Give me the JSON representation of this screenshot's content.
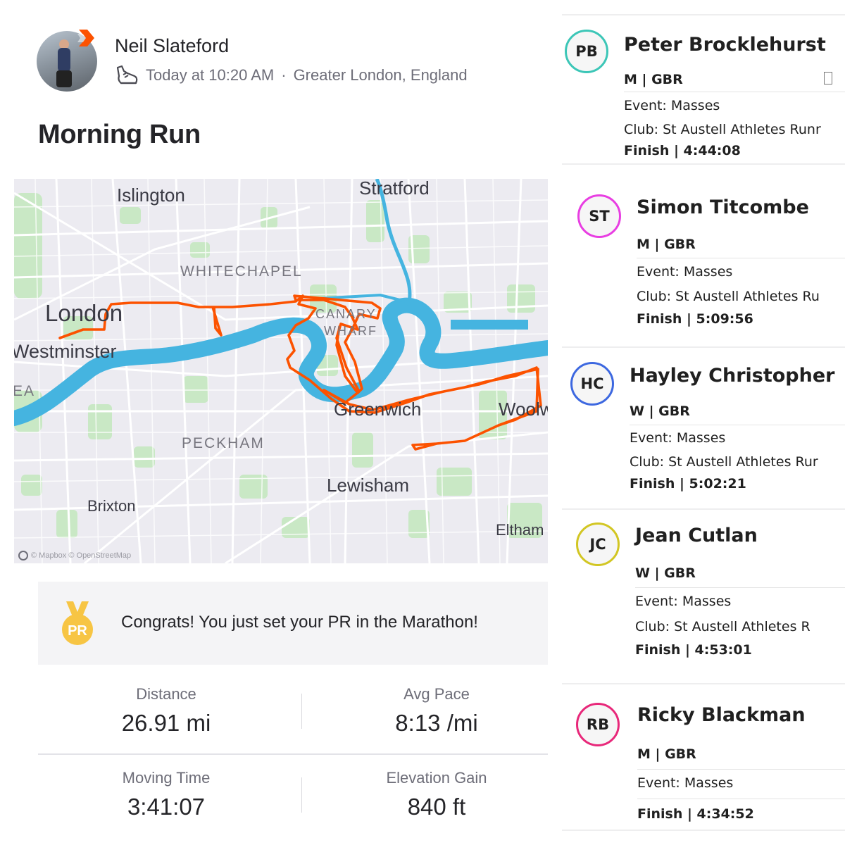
{
  "activity": {
    "athlete_name": "Neil Slateford",
    "timestamp": "Today at 10:20 AM",
    "location": "Greater London, England",
    "meta_separator": "·",
    "title": "Morning Run",
    "activity_icon": "running-shoe-icon",
    "accent_color": "#fc5200"
  },
  "map": {
    "labels": {
      "islington": "Islington",
      "stratford": "Stratford",
      "whitechapel": "WHITECHAPEL",
      "london": "London",
      "canary_wharf_1": "CANARY",
      "canary_wharf_2": "WHARF",
      "westminster": "Westminster",
      "ea": "EA",
      "greenwich": "Greenwich",
      "woolwich": "Woolw",
      "peckham": "PECKHAM",
      "lewisham": "Lewisham",
      "brixton": "Brixton",
      "eltham": "Eltham"
    },
    "attribution": "© Mapbox © OpenStreetMap",
    "route_color": "#fc5200",
    "river_color": "#45b4e0",
    "park_color": "#c9e8c5"
  },
  "pr": {
    "medal_text": "PR",
    "message": "Congrats! You just set your PR in the Marathon!",
    "medal_color": "#f7c544"
  },
  "stats": {
    "distance_label": "Distance",
    "distance_value": "26.91 mi",
    "pace_label": "Avg Pace",
    "pace_value": "8:13 /mi",
    "moving_time_label": "Moving Time",
    "moving_time_value": "3:41:07",
    "elevation_label": "Elevation Gain",
    "elevation_value": "840 ft"
  },
  "runners": [
    {
      "initials": "PB",
      "name": "Peter Brocklehurst",
      "category": "M | GBR",
      "event": "Event: Masses",
      "club": "Club: St Austell Athletes Runr",
      "finish": "Finish | 4:44:08",
      "ring_color": "#3cc6b7"
    },
    {
      "initials": "ST",
      "name": "Simon Titcombe",
      "category": "M | GBR",
      "event": "Event: Masses",
      "club": "Club: St Austell Athletes Ru",
      "finish": "Finish | 5:09:56",
      "ring_color": "#e83ee2"
    },
    {
      "initials": "HC",
      "name": "Hayley Christopher",
      "category": "W | GBR",
      "event": "Event: Masses",
      "club": "Club: St Austell Athletes Rur",
      "finish": "Finish | 5:02:21",
      "ring_color": "#3d68e0"
    },
    {
      "initials": "JC",
      "name": "Jean Cutlan",
      "category": "W | GBR",
      "event": "Event: Masses",
      "club": "Club: St Austell Athletes R",
      "finish": "Finish | 4:53:01",
      "ring_color": "#d2c623"
    },
    {
      "initials": "RB",
      "name": "Ricky Blackman",
      "category": "M | GBR",
      "event": "Event: Masses",
      "finish": "Finish | 4:34:52",
      "ring_color": "#e8287a"
    }
  ]
}
